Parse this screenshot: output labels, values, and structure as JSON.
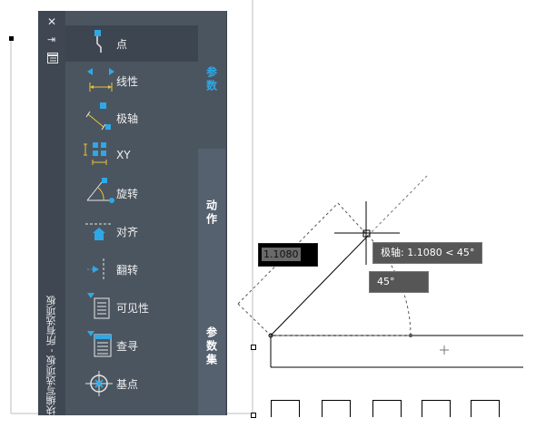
{
  "palette": {
    "title": "块编写选项板 - 所有选项板",
    "items": [
      {
        "label": "点",
        "icon": "point-param-icon"
      },
      {
        "label": "线性",
        "icon": "linear-param-icon"
      },
      {
        "label": "极轴",
        "icon": "polar-param-icon"
      },
      {
        "label": "XY",
        "icon": "xy-param-icon"
      },
      {
        "label": "旋转",
        "icon": "rotation-param-icon"
      },
      {
        "label": "对齐",
        "icon": "alignment-param-icon"
      },
      {
        "label": "翻转",
        "icon": "flip-param-icon"
      },
      {
        "label": "可见性",
        "icon": "visibility-param-icon"
      },
      {
        "label": "查寻",
        "icon": "lookup-param-icon"
      },
      {
        "label": "基点",
        "icon": "basepoint-param-icon"
      }
    ],
    "tabs": {
      "params": "参数",
      "actions": "动作",
      "param_sets": "参数集"
    },
    "accent": "#2fa8e6"
  },
  "canvas": {
    "dynamic_input_value": "1.1080",
    "polar_tooltip": "极轴: 1.1080 < 45°",
    "angle_tooltip": "45°"
  }
}
